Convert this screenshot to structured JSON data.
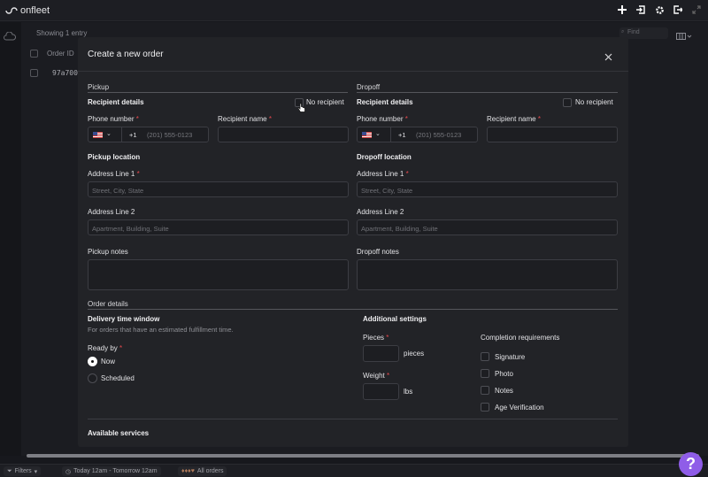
{
  "app": {
    "brand": "onfleet"
  },
  "background": {
    "showing": "Showing 1 entry",
    "find_placeholder": "Find",
    "column_order_id": "Order ID",
    "row_order_id": "97a7002"
  },
  "modal": {
    "title": "Create a new order",
    "pickup": {
      "section": "Pickup",
      "recipient_details": "Recipient details",
      "no_recipient": "No recipient",
      "phone_label": "Phone number",
      "country_code": "+1",
      "phone_placeholder": "(201) 555-0123",
      "name_label": "Recipient name",
      "location_title": "Pickup location",
      "address1_label": "Address Line 1",
      "address1_placeholder": "Street, City, State",
      "address2_label": "Address Line 2",
      "address2_placeholder": "Apartment, Building, Suite",
      "notes_label": "Pickup notes"
    },
    "dropoff": {
      "section": "Dropoff",
      "recipient_details": "Recipient details",
      "no_recipient": "No recipient",
      "phone_label": "Phone number",
      "country_code": "+1",
      "phone_placeholder": "(201) 555-0123",
      "name_label": "Recipient name",
      "location_title": "Dropoff location",
      "address1_label": "Address Line 1",
      "address1_placeholder": "Street, City, State",
      "address2_label": "Address Line 2",
      "address2_placeholder": "Apartment, Building, Suite",
      "notes_label": "Dropoff notes"
    },
    "order_details": {
      "section": "Order details",
      "window_title": "Delivery time window",
      "window_help": "For orders that have an estimated fulfillment time.",
      "ready_by_label": "Ready by",
      "ready_now": "Now",
      "ready_scheduled": "Scheduled",
      "additional_title": "Additional settings",
      "pieces_label": "Pieces",
      "pieces_unit": "pieces",
      "weight_label": "Weight",
      "weight_unit": "lbs",
      "completion_title": "Completion requirements",
      "signature": "Signature",
      "photo": "Photo",
      "notes": "Notes",
      "age_verification": "Age Verification"
    },
    "services": {
      "title": "Available services"
    },
    "required_mark": "*"
  },
  "bottom": {
    "filters": "Filters",
    "time_range": "Today 12am - Tomorrow 12am",
    "all_orders": "All orders"
  },
  "help_button": "?"
}
